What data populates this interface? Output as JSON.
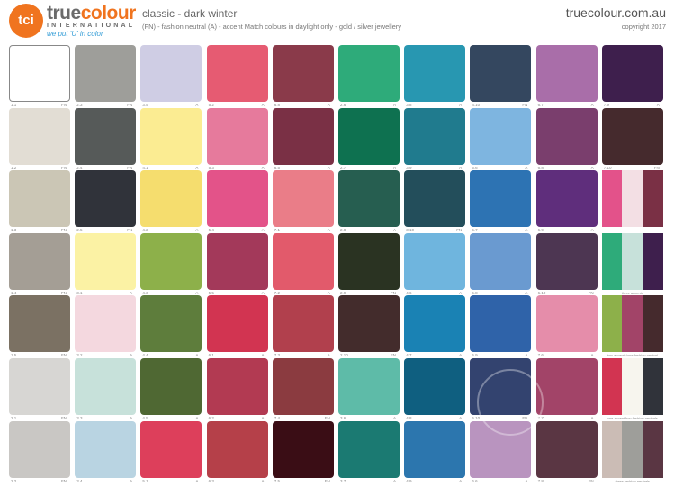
{
  "header": {
    "logo_text": "tci",
    "brand_part1": "true",
    "brand_part2": "colour",
    "brand_sub": "INTERNATIONAL",
    "tagline": "we put 'U' in color",
    "title": "classic - dark winter",
    "subtitle": "(FN) - fashion neutral     (A) - accent     Match colours in daylight only - gold / silver jewellery",
    "site": "truecolour.com.au",
    "copyright": "copyright 2017"
  },
  "colors": {
    "brand_orange": "#f0741f",
    "brand_blue": "#3aa0d8"
  },
  "rows": [
    [
      {
        "code": "1.1",
        "type": "FN",
        "color": "#ffffff"
      },
      {
        "code": "2.3",
        "type": "FN",
        "color": "#9e9e9a"
      },
      {
        "code": "3.5",
        "type": "A",
        "color": "#cfcde4"
      },
      {
        "code": "5.2",
        "type": "A",
        "color": "#e65b72"
      },
      {
        "code": "6.8",
        "type": "A",
        "color": "#8a3a4a"
      },
      {
        "code": "2.6",
        "type": "A",
        "color": "#2eab7a"
      },
      {
        "code": "3.8",
        "type": "A",
        "color": "#2897b1"
      },
      {
        "code": "4.10",
        "type": "FN",
        "color": "#34475f"
      },
      {
        "code": "6.7",
        "type": "A",
        "color": "#a96ea9"
      },
      {
        "code": "7.9",
        "type": "A",
        "color": "#3e1f4d"
      }
    ],
    [
      {
        "code": "1.2",
        "type": "FN",
        "color": "#e2ddd4"
      },
      {
        "code": "2.4",
        "type": "FN",
        "color": "#565a59"
      },
      {
        "code": "4.1",
        "type": "A",
        "color": "#fbec92"
      },
      {
        "code": "5.3",
        "type": "A",
        "color": "#e67a9c"
      },
      {
        "code": "6.5",
        "type": "A",
        "color": "#7a3045"
      },
      {
        "code": "2.7",
        "type": "A",
        "color": "#0e7150"
      },
      {
        "code": "3.9",
        "type": "A",
        "color": "#207b8e"
      },
      {
        "code": "5.6",
        "type": "A",
        "color": "#7eb5e0"
      },
      {
        "code": "6.8",
        "type": "A",
        "color": "#7a3e6d"
      },
      {
        "code": "7.10",
        "type": "FN",
        "color": "#452a2d"
      }
    ],
    [
      {
        "code": "1.3",
        "type": "FN",
        "color": "#cbc6b5"
      },
      {
        "code": "2.5",
        "type": "FN",
        "color": "#30333a"
      },
      {
        "code": "4.2",
        "type": "A",
        "color": "#f5dd6e"
      },
      {
        "code": "5.4",
        "type": "A",
        "color": "#e35389"
      },
      {
        "code": "7.1",
        "type": "A",
        "color": "#ea7d88"
      },
      {
        "code": "2.8",
        "type": "A",
        "color": "#265e50"
      },
      {
        "code": "3.10",
        "type": "FN",
        "color": "#234e5b"
      },
      {
        "code": "5.7",
        "type": "A",
        "color": "#2d73b3"
      },
      {
        "code": "6.9",
        "type": "A",
        "color": "#5f2e7c"
      },
      {
        "code": "combo1",
        "type": "",
        "color": ""
      }
    ],
    [
      {
        "code": "1.4",
        "type": "FN",
        "color": "#a49e95"
      },
      {
        "code": "3.1",
        "type": "A",
        "color": "#fbf2a4"
      },
      {
        "code": "4.3",
        "type": "A",
        "color": "#8db04a"
      },
      {
        "code": "5.5",
        "type": "A",
        "color": "#a3395a"
      },
      {
        "code": "7.2",
        "type": "A",
        "color": "#e25a6b"
      },
      {
        "code": "2.9",
        "type": "FN",
        "color": "#2a3322"
      },
      {
        "code": "4.6",
        "type": "A",
        "color": "#6fb5de"
      },
      {
        "code": "5.8",
        "type": "A",
        "color": "#6a9ad0"
      },
      {
        "code": "6.10",
        "type": "FN",
        "color": "#4d3652"
      },
      {
        "code": "combo2",
        "type": "",
        "color": ""
      }
    ],
    [
      {
        "code": "1.5",
        "type": "FN",
        "color": "#7b7163"
      },
      {
        "code": "3.2",
        "type": "A",
        "color": "#f4d8df"
      },
      {
        "code": "4.4",
        "type": "A",
        "color": "#5e7d3c"
      },
      {
        "code": "6.1",
        "type": "A",
        "color": "#d23451"
      },
      {
        "code": "7.3",
        "type": "A",
        "color": "#b1404d"
      },
      {
        "code": "2.10",
        "type": "FN",
        "color": "#432c2c"
      },
      {
        "code": "4.7",
        "type": "A",
        "color": "#1a82b4"
      },
      {
        "code": "5.9",
        "type": "A",
        "color": "#2f63a9"
      },
      {
        "code": "7.6",
        "type": "A",
        "color": "#e58daa"
      },
      {
        "code": "combo3",
        "type": "",
        "color": ""
      }
    ],
    [
      {
        "code": "2.1",
        "type": "FN",
        "color": "#d7d6d3"
      },
      {
        "code": "3.3",
        "type": "A",
        "color": "#c7e1da"
      },
      {
        "code": "4.5",
        "type": "A",
        "color": "#4f6833"
      },
      {
        "code": "6.2",
        "type": "A",
        "color": "#b23a52"
      },
      {
        "code": "7.4",
        "type": "FN",
        "color": "#8b3b40"
      },
      {
        "code": "3.6",
        "type": "A",
        "color": "#5ebba8"
      },
      {
        "code": "4.8",
        "type": "A",
        "color": "#0f5f80"
      },
      {
        "code": "5.10",
        "type": "FN",
        "color": "#33436f"
      },
      {
        "code": "7.7",
        "type": "A",
        "color": "#a24468"
      },
      {
        "code": "combo4",
        "type": "",
        "color": ""
      }
    ],
    [
      {
        "code": "2.2",
        "type": "FN",
        "color": "#c9c7c4"
      },
      {
        "code": "3.4",
        "type": "A",
        "color": "#b9d4e2"
      },
      {
        "code": "5.1",
        "type": "A",
        "color": "#dd3f5b"
      },
      {
        "code": "6.3",
        "type": "A",
        "color": "#b54049"
      },
      {
        "code": "7.5",
        "type": "FN",
        "color": "#3a0d15"
      },
      {
        "code": "3.7",
        "type": "A",
        "color": "#1b7a72"
      },
      {
        "code": "4.9",
        "type": "A",
        "color": "#2c76ae"
      },
      {
        "code": "6.6",
        "type": "A",
        "color": "#b994bf"
      },
      {
        "code": "7.8",
        "type": "FN",
        "color": "#5a3643"
      },
      {
        "code": "combo5",
        "type": "",
        "color": ""
      }
    ]
  ],
  "combos": {
    "combo1": {
      "caption": "",
      "colors": [
        "#e3528a",
        "#f3dfe4",
        "#7a3045"
      ]
    },
    "combo2": {
      "caption": "three accents",
      "colors": [
        "#2eab7a",
        "#c7e1da",
        "#3e1f4d"
      ]
    },
    "combo3": {
      "caption": "two accents/one fashion neutral",
      "colors": [
        "#8db04a",
        "#a24468",
        "#452a2d"
      ]
    },
    "combo4": {
      "caption": "one accent/two fashion neutrals",
      "colors": [
        "#d23451",
        "#f7f5ee",
        "#30333a"
      ]
    },
    "combo5": {
      "caption": "three fashion neutrals",
      "colors": [
        "#cbbcb5",
        "#9e9e9a",
        "#5a3643"
      ]
    }
  }
}
